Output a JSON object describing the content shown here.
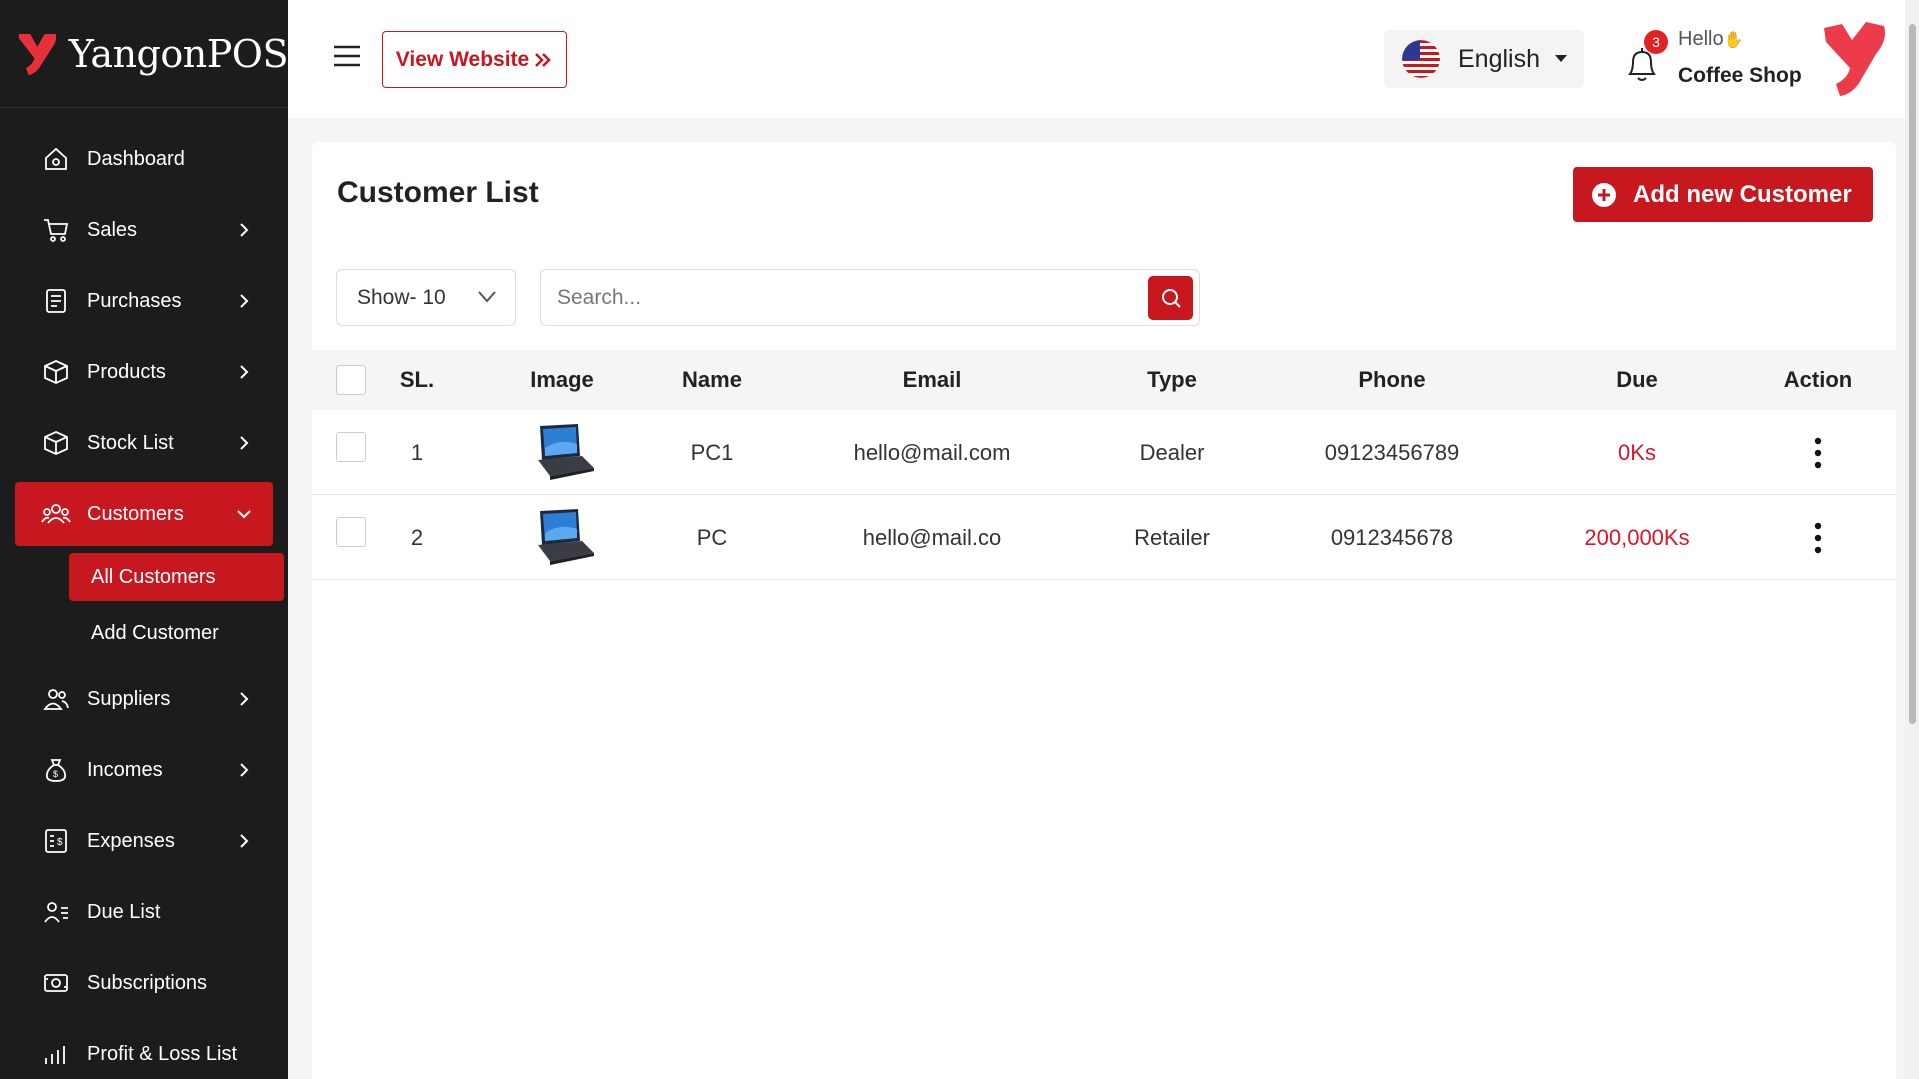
{
  "brand": {
    "name": "YangonPOS"
  },
  "sidebar": {
    "items": [
      {
        "label": "Dashboard",
        "icon": "home-icon",
        "chevron": false
      },
      {
        "label": "Sales",
        "icon": "cart-icon",
        "chevron": true
      },
      {
        "label": "Purchases",
        "icon": "receipt-icon",
        "chevron": true
      },
      {
        "label": "Products",
        "icon": "box-icon",
        "chevron": true
      },
      {
        "label": "Stock List",
        "icon": "box-icon",
        "chevron": true
      },
      {
        "label": "Customers",
        "icon": "users-icon",
        "chevron": true,
        "active": true
      },
      {
        "label": "Suppliers",
        "icon": "users-icon",
        "chevron": true
      },
      {
        "label": "Incomes",
        "icon": "money-bag-icon",
        "chevron": true
      },
      {
        "label": "Expenses",
        "icon": "receipt-icon",
        "chevron": true
      },
      {
        "label": "Due List",
        "icon": "user-list-icon",
        "chevron": false
      },
      {
        "label": "Subscriptions",
        "icon": "subscription-icon",
        "chevron": false
      },
      {
        "label": "Profit & Loss List",
        "icon": "chart-icon",
        "chevron": false
      }
    ],
    "submenu": [
      {
        "label": "All Customers",
        "active": true
      },
      {
        "label": "Add Customer",
        "active": false
      }
    ]
  },
  "header": {
    "view_website": "View Website",
    "language": "English",
    "notification_count": "3",
    "greeting": "Hello",
    "shop_name": "Coffee Shop"
  },
  "page": {
    "title": "Customer List",
    "add_button": "Add new Customer",
    "show_select": "Show- 10",
    "search_placeholder": "Search..."
  },
  "table": {
    "headers": [
      "SL.",
      "Image",
      "Name",
      "Email",
      "Type",
      "Phone",
      "Due",
      "Action"
    ],
    "rows": [
      {
        "sl": "1",
        "name": "PC1",
        "email": "hello@mail.com",
        "type": "Dealer",
        "phone": "09123456789",
        "due": "0Ks"
      },
      {
        "sl": "2",
        "name": "PC",
        "email": "hello@mail.co",
        "type": "Retailer",
        "phone": "0912345678",
        "due": "200,000Ks"
      }
    ]
  },
  "colors": {
    "brand_red": "#c8181f",
    "sidebar_bg": "#1c1c1c",
    "due_red": "#d11a2a"
  }
}
